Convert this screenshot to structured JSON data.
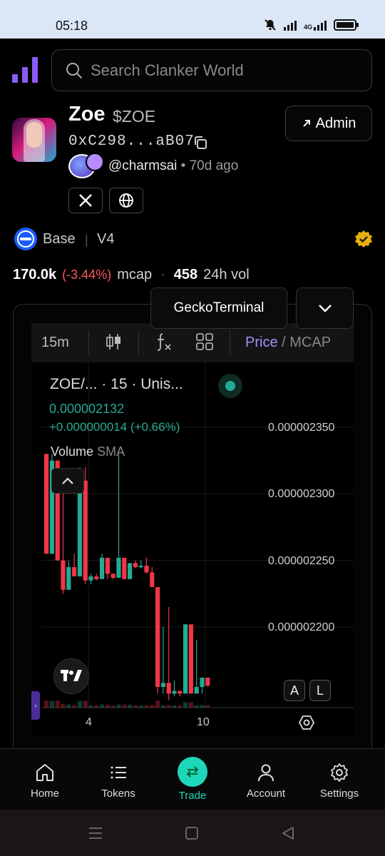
{
  "status_bar": {
    "time": "05:18",
    "network": "4G"
  },
  "header": {
    "search_placeholder": "Search Clanker World"
  },
  "token": {
    "name": "Zoe",
    "symbol": "$ZOE",
    "address": "0xC298...aB07",
    "creator_handle": "@charmsai",
    "creator_age": "• 70d ago",
    "admin_label": "Admin",
    "chain": "Base",
    "version": "V4",
    "verified": true
  },
  "stats": {
    "mcap_value": "170.0k",
    "mcap_change": "(-3.44%)",
    "mcap_label": "mcap",
    "volume_value": "458",
    "volume_label": "24h vol"
  },
  "chart_panel": {
    "source_label": "GeckoTerminal",
    "interval": "15m",
    "mode_active": "Price",
    "mode_separator": "/",
    "mode_inactive": "MCAP",
    "pair_title": "ZOE/...  · 15 · Unis...",
    "last_price": "0.000002132",
    "change": "+0.000000014 (+0.66%)",
    "volume_label": "Volume",
    "sma_label": "SMA",
    "scale_auto": "A",
    "scale_log": "L",
    "up_color": "#22ab94",
    "down_color": "#f23645"
  },
  "chart_data": {
    "type": "candlestick",
    "x_tick_labels": [
      "4",
      "10"
    ],
    "y_tick_labels": [
      "0.000002350",
      "0.000002300",
      "0.000002250",
      "0.000002200"
    ],
    "candles": [
      {
        "o": 2.33,
        "h": 2.33,
        "l": 2.255,
        "c": 2.255
      },
      {
        "o": 2.255,
        "h": 2.33,
        "l": 2.255,
        "c": 2.325
      },
      {
        "o": 2.325,
        "h": 2.325,
        "l": 2.25,
        "c": 2.25
      },
      {
        "o": 2.25,
        "h": 2.3,
        "l": 2.225,
        "c": 2.228
      },
      {
        "o": 2.228,
        "h": 2.25,
        "l": 2.228,
        "c": 2.245
      },
      {
        "o": 2.245,
        "h": 2.255,
        "l": 2.238,
        "c": 2.238
      },
      {
        "o": 2.238,
        "h": 2.32,
        "l": 2.238,
        "c": 2.31
      },
      {
        "o": 2.31,
        "h": 2.32,
        "l": 2.232,
        "c": 2.235
      },
      {
        "o": 2.235,
        "h": 2.24,
        "l": 2.232,
        "c": 2.238
      },
      {
        "o": 2.238,
        "h": 2.24,
        "l": 2.235,
        "c": 2.236
      },
      {
        "o": 2.236,
        "h": 2.255,
        "l": 2.236,
        "c": 2.252
      },
      {
        "o": 2.252,
        "h": 2.252,
        "l": 2.236,
        "c": 2.24
      },
      {
        "o": 2.24,
        "h": 2.24,
        "l": 2.236,
        "c": 2.237
      },
      {
        "o": 2.237,
        "h": 2.33,
        "l": 2.237,
        "c": 2.252
      },
      {
        "o": 2.252,
        "h": 2.252,
        "l": 2.236,
        "c": 2.236
      },
      {
        "o": 2.236,
        "h": 2.248,
        "l": 2.236,
        "c": 2.248
      },
      {
        "o": 2.248,
        "h": 2.25,
        "l": 2.244,
        "c": 2.245
      },
      {
        "o": 2.245,
        "h": 2.25,
        "l": 2.244,
        "c": 2.246
      },
      {
        "o": 2.246,
        "h": 2.252,
        "l": 2.24,
        "c": 2.241
      },
      {
        "o": 2.241,
        "h": 2.245,
        "l": 2.23,
        "c": 2.23
      },
      {
        "o": 2.23,
        "h": 2.23,
        "l": 2.15,
        "c": 2.155
      },
      {
        "o": 2.155,
        "h": 2.2,
        "l": 2.15,
        "c": 2.158
      },
      {
        "o": 2.158,
        "h": 2.215,
        "l": 2.145,
        "c": 2.15
      },
      {
        "o": 2.15,
        "h": 2.16,
        "l": 2.148,
        "c": 2.152
      },
      {
        "o": 2.152,
        "h": 2.152,
        "l": 2.148,
        "c": 2.15
      },
      {
        "o": 2.15,
        "h": 2.202,
        "l": 2.15,
        "c": 2.202
      },
      {
        "o": 2.202,
        "h": 2.202,
        "l": 2.15,
        "c": 2.15
      },
      {
        "o": 2.15,
        "h": 2.19,
        "l": 2.15,
        "c": 2.155
      },
      {
        "o": 2.155,
        "h": 2.162,
        "l": 2.15,
        "c": 2.162
      },
      {
        "o": 2.162,
        "h": 2.162,
        "l": 2.155,
        "c": 2.156
      }
    ]
  },
  "nav": {
    "items": [
      {
        "label": "Home",
        "icon": "home-icon"
      },
      {
        "label": "Tokens",
        "icon": "list-icon"
      },
      {
        "label": "Trade",
        "icon": "swap-icon"
      },
      {
        "label": "Account",
        "icon": "user-icon"
      },
      {
        "label": "Settings",
        "icon": "gear-icon"
      }
    ],
    "active": "Trade"
  }
}
